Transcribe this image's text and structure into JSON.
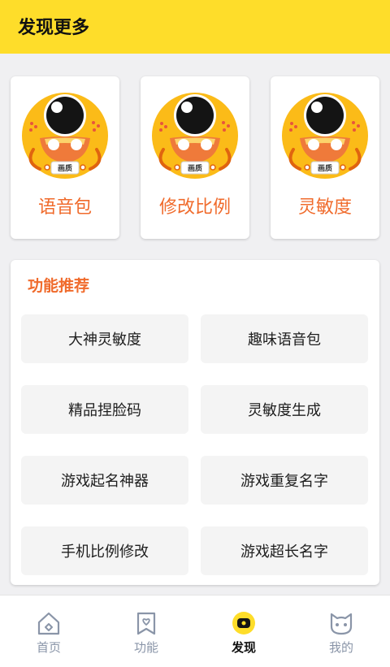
{
  "header": {
    "title": "发现更多"
  },
  "cards": [
    {
      "label": "语音包",
      "badge": "画质"
    },
    {
      "label": "修改比例",
      "badge": "画质"
    },
    {
      "label": "灵敏度",
      "badge": "画质"
    }
  ],
  "features": {
    "title": "功能推荐",
    "items": [
      {
        "label": "大神灵敏度"
      },
      {
        "label": "趣味语音包"
      },
      {
        "label": "精品捏脸码"
      },
      {
        "label": "灵敏度生成"
      },
      {
        "label": "游戏起名神器"
      },
      {
        "label": "游戏重复名字"
      },
      {
        "label": "手机比例修改"
      },
      {
        "label": "游戏超长名字"
      }
    ]
  },
  "nav": {
    "items": [
      {
        "label": "首页",
        "icon": "home-icon"
      },
      {
        "label": "功能",
        "icon": "bookmark-heart-icon"
      },
      {
        "label": "发现",
        "icon": "discover-icon",
        "active": true
      },
      {
        "label": "我的",
        "icon": "cat-face-icon"
      }
    ]
  },
  "colors": {
    "brand_yellow": "#fedd2a",
    "accent_orange": "#f06b2c",
    "nav_inactive": "#8a95a8",
    "nav_active": "#111111"
  }
}
